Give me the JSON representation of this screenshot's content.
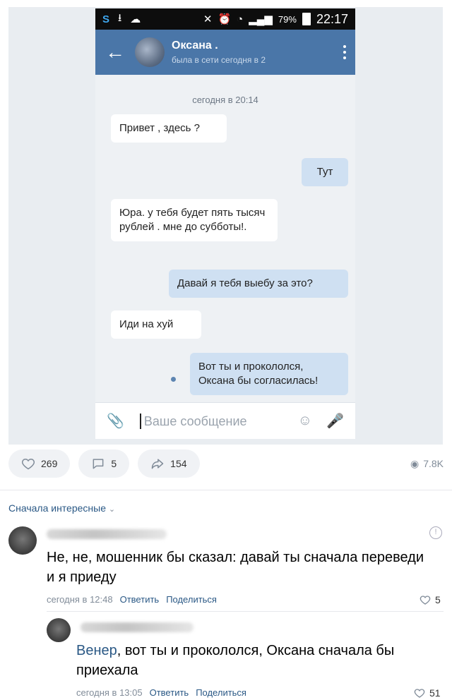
{
  "screenshot": {
    "statusbar": {
      "battery_pct": "79%",
      "time": "22:17"
    },
    "contact": {
      "name": "Оксана .",
      "status": "была в сети сегодня в 2"
    },
    "date_separator": "сегодня в 20:14",
    "messages": [
      {
        "side": "in",
        "text": "Привет , здесь ?"
      },
      {
        "side": "out",
        "text": "Тут"
      },
      {
        "side": "in",
        "text": "Юра. у тебя будет пять тысяч рублей . мне до субботы!."
      },
      {
        "side": "out",
        "text": "Давай я тебя выебу за это?"
      },
      {
        "side": "in",
        "text": "Иди на хуй"
      },
      {
        "side": "out",
        "text": "Вот ты и прокололся, Оксана бы согласилась!"
      }
    ],
    "composer_placeholder": "Ваше сообщение"
  },
  "post_actions": {
    "likes": "269",
    "comments": "5",
    "shares": "154",
    "views": "7.8K"
  },
  "comments_sort": "Сначала интересные",
  "comments": [
    {
      "text": "Не, не, мошенник бы сказал: давай ты сначала переведи и я приеду",
      "time": "сегодня в 12:48",
      "reply": "Ответить",
      "share": "Поделиться",
      "likes": "5"
    },
    {
      "mention": "Венер",
      "text": ", вот ты и прокололся, Оксана сначала бы приехала",
      "time": "сегодня в 13:05",
      "reply": "Ответить",
      "share": "Поделиться",
      "likes": "51"
    }
  ],
  "colors": {
    "vk_blue": "#4a76a8",
    "link": "#2a5885",
    "bubble_out": "#cfe0f2"
  },
  "icons": [
    "back-arrow-icon",
    "more-vertical-icon",
    "paperclip-icon",
    "smile-icon",
    "microphone-icon",
    "heart-icon",
    "comment-icon",
    "share-icon",
    "eye-icon",
    "info-icon"
  ]
}
